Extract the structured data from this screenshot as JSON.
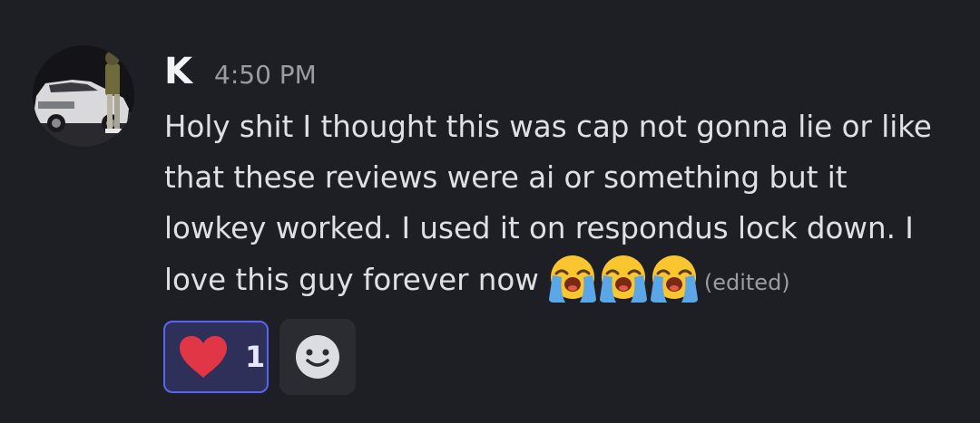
{
  "message": {
    "username": "K",
    "timestamp": "4:50 PM",
    "lines": [
      "Holy shit I thought this was cap not gonna lie or like",
      "that these reviews were ai or something but it",
      "lowkey worked. I used it on respondus lock down. I",
      "love this guy forever now"
    ],
    "emojis": [
      "loudly-crying-face",
      "loudly-crying-face",
      "loudly-crying-face"
    ],
    "edited_label": "(edited)"
  },
  "reactions": [
    {
      "emoji": "heart-icon",
      "count": "1",
      "color": "#e03645"
    }
  ],
  "add_reaction_icon": "smiley-icon",
  "colors": {
    "background": "#1e1f24",
    "accent": "#5865f2",
    "reaction_bg": "#2e305a"
  }
}
